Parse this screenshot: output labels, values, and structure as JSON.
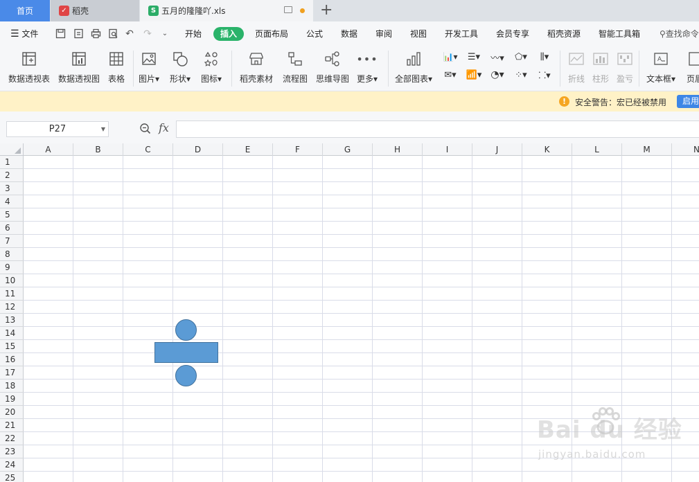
{
  "tabs": {
    "home": "首页",
    "daoke": "稻壳",
    "file": "五月的隆隆吖.xls"
  },
  "menu": {
    "file": "文件",
    "items": [
      "开始",
      "插入",
      "页面布局",
      "公式",
      "数据",
      "审阅",
      "视图",
      "开发工具",
      "会员专享",
      "稻壳资源",
      "智能工具箱"
    ],
    "active": "插入",
    "search": "查找命令"
  },
  "ribbon": {
    "pivot_table": "数据透视表",
    "pivot_chart": "数据透视图",
    "table": "表格",
    "picture": "图片",
    "shape": "形状",
    "icon": "图标",
    "daoke_material": "稻壳素材",
    "flowchart": "流程图",
    "mindmap": "思维导图",
    "more": "更多",
    "all_charts": "全部图表",
    "sparkline_line": "折线",
    "sparkline_column": "柱形",
    "sparkline_winloss": "盈亏",
    "textbox": "文本框",
    "header_footer": "页眉"
  },
  "warning": {
    "text": "安全警告：宏已经被禁用",
    "button": "启用"
  },
  "formula_bar": {
    "cell_ref": "P27",
    "fx": "fx",
    "value": ""
  },
  "sheet": {
    "columns": [
      "A",
      "B",
      "C",
      "D",
      "E",
      "F",
      "G",
      "H",
      "I",
      "J",
      "K",
      "L",
      "M",
      "N"
    ],
    "rows": [
      "1",
      "2",
      "3",
      "4",
      "5",
      "6",
      "7",
      "8",
      "9",
      "10",
      "11",
      "12",
      "13",
      "14",
      "15",
      "16",
      "17",
      "18",
      "19",
      "20",
      "21",
      "22",
      "23",
      "24",
      "25"
    ]
  },
  "colors": {
    "accent_green": "#2ab36a",
    "home_tab": "#4a8ae8",
    "shape_fill": "#5b9bd5",
    "shape_border": "#41719c",
    "warning_bg": "#fff2c7"
  },
  "watermark": {
    "logo": "Bai du 经验",
    "url": "jingyan.baidu.com"
  }
}
